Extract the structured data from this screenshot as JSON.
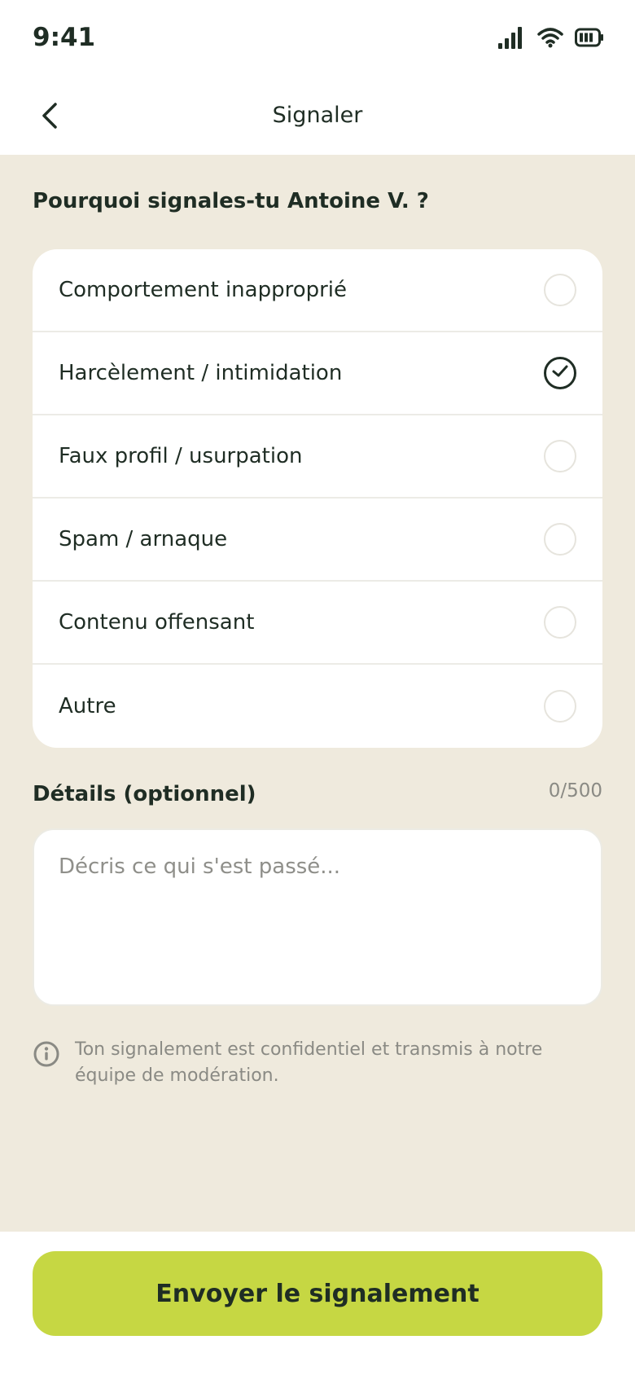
{
  "status": {
    "time": "9:41"
  },
  "header": {
    "title": "Signaler"
  },
  "question": "Pourquoi signales-tu Antoine V. ?",
  "options": [
    {
      "label": "Comportement inapproprié",
      "selected": false
    },
    {
      "label": "Harcèlement / intimidation",
      "selected": true
    },
    {
      "label": "Faux profil / usurpation",
      "selected": false
    },
    {
      "label": "Spam / arnaque",
      "selected": false
    },
    {
      "label": "Contenu offensant",
      "selected": false
    },
    {
      "label": "Autre",
      "selected": false
    }
  ],
  "details": {
    "label": "Détails (optionnel)",
    "counter": "0/500",
    "placeholder": "Décris ce qui s'est passé...",
    "value": ""
  },
  "info": "Ton signalement est confidentiel et transmis à notre équipe de modération.",
  "submit_label": "Envoyer le signalement",
  "colors": {
    "accent": "#c6d743",
    "background": "#efeadd",
    "text": "#1f2d24"
  }
}
